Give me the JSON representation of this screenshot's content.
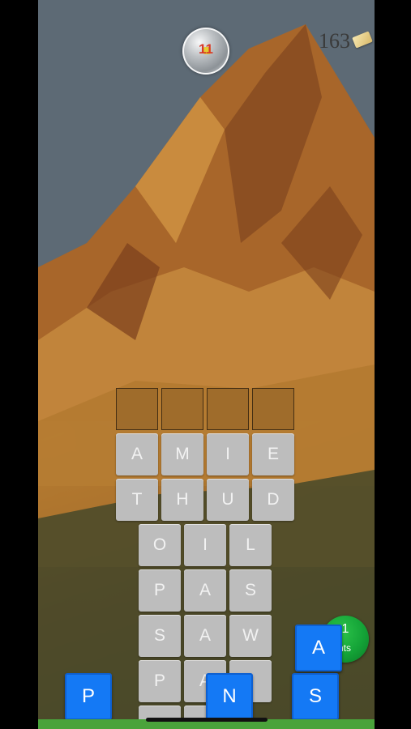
{
  "hud": {
    "level": "11",
    "coins": "163",
    "coin_icon": "gold-bar-icon"
  },
  "answer_slots": 4,
  "grid": {
    "rows": [
      [
        "A",
        "M",
        "I",
        "E"
      ],
      [
        "T",
        "H",
        "U",
        "D"
      ],
      [
        "O",
        "I",
        "L"
      ],
      [
        "P",
        "A",
        "S"
      ],
      [
        "S",
        "A",
        "W"
      ],
      [
        "P",
        "A",
        "I"
      ]
    ]
  },
  "falling_tiles": {
    "p": "P",
    "n": "N",
    "a": "A",
    "s": "S"
  },
  "hint_button": {
    "count": "1",
    "label": "nts"
  },
  "colors": {
    "tile": "#bdbdbd",
    "falling_tile": "#1479f5",
    "hint": "#14a337",
    "level_number": "#d83a2a"
  }
}
